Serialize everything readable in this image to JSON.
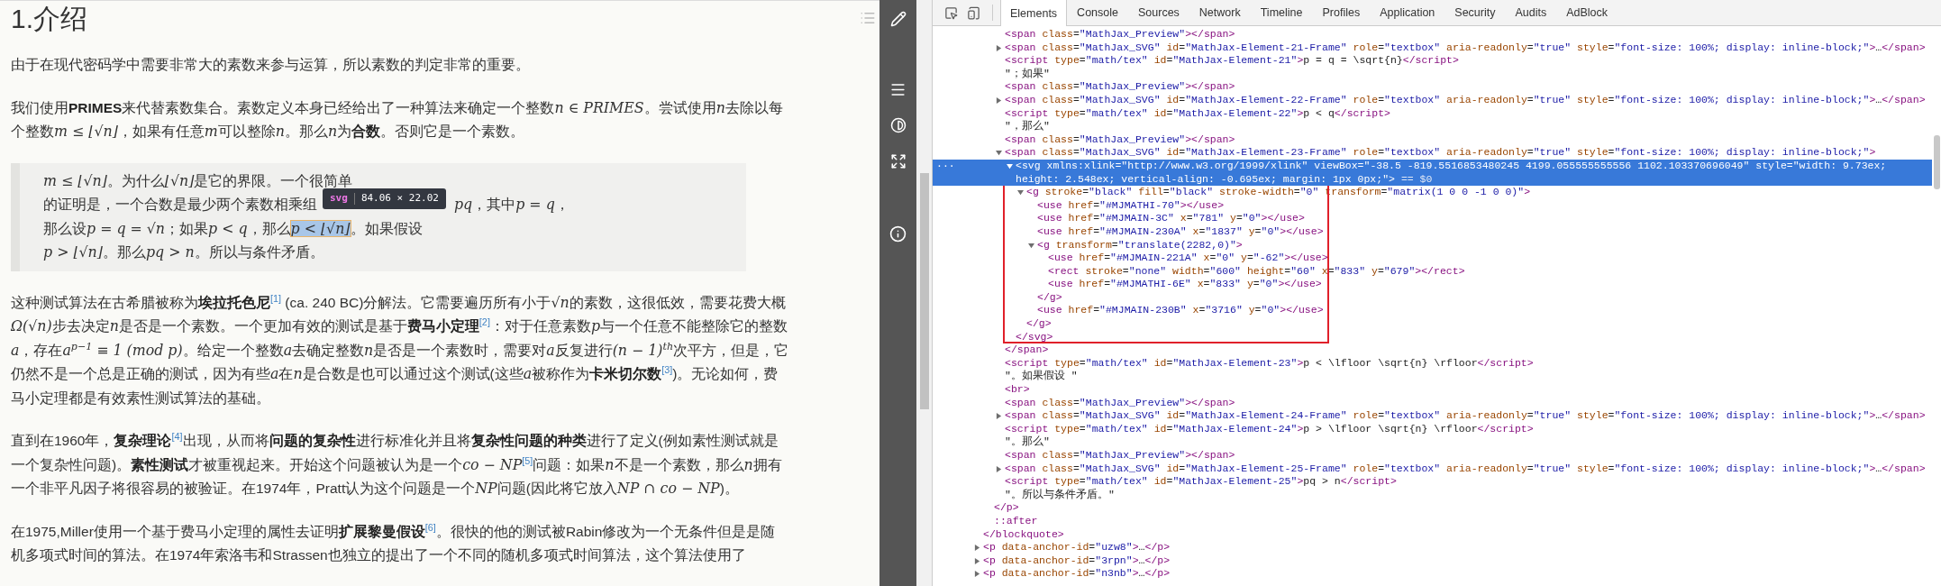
{
  "article": {
    "heading": "1.介绍",
    "blocks": [
      {
        "kind": "paragraph",
        "runs": [
          {
            "kind": "text",
            "text": "由于在现代密码学中需要非常大的素数来参与运算，所以素数的判定非常的重要。"
          }
        ]
      },
      {
        "kind": "paragraph",
        "runs": [
          {
            "kind": "text",
            "text": "我们使用**PRIMES**来代替素数集合。素数定义本身已经给出了一种算法来确定一个整数"
          },
          {
            "kind": "math",
            "text": "n ∈ PRIMES"
          },
          {
            "kind": "text",
            "text": "。尝试使用"
          },
          {
            "kind": "math",
            "text": "n"
          },
          {
            "kind": "text",
            "text": "去除以每个整数"
          },
          {
            "kind": "math",
            "text": "m ≤ ⌊√n⌋"
          },
          {
            "kind": "text",
            "text": "，如果有任意"
          },
          {
            "kind": "math",
            "text": "m"
          },
          {
            "kind": "text",
            "text": "可以整除"
          },
          {
            "kind": "math",
            "text": "n"
          },
          {
            "kind": "text",
            "text": "。那么"
          },
          {
            "kind": "math",
            "text": "n"
          },
          {
            "kind": "text",
            "text": "为**合数**。否则它是一个素数。"
          }
        ]
      },
      {
        "kind": "quote",
        "lines": [
          [
            {
              "kind": "math",
              "text": "m ≤ ⌊√n⌋"
            },
            {
              "kind": "text",
              "text": "。为什么"
            },
            {
              "kind": "math",
              "text": "⌊√n⌋"
            },
            {
              "kind": "text",
              "text": "是它的界限。一个很简单"
            }
          ],
          [
            {
              "kind": "text",
              "text": "的证明是，一个合数是最少两个素数相乘组"
            },
            {
              "kind": "gap",
              "tooltip": {
                "tag": "svg",
                "size": "84.06 × 22.02"
              }
            },
            {
              "kind": "math",
              "text": "pq"
            },
            {
              "kind": "text",
              "text": "，其中"
            },
            {
              "kind": "math",
              "text": "p = q"
            },
            {
              "kind": "text",
              "text": "，"
            }
          ],
          [
            {
              "kind": "text",
              "text": "那么设"
            },
            {
              "kind": "math",
              "text": "p = q = √n"
            },
            {
              "kind": "text",
              "text": "；如果"
            },
            {
              "kind": "math",
              "text": "p < q"
            },
            {
              "kind": "text",
              "text": "，那么"
            },
            {
              "kind": "highlight",
              "text": "p < ⌊√n⌋"
            },
            {
              "kind": "text",
              "text": "。如果假设"
            }
          ],
          [
            {
              "kind": "math",
              "text": "p > ⌊√n⌋"
            },
            {
              "kind": "text",
              "text": "。那么"
            },
            {
              "kind": "math",
              "text": "pq > n"
            },
            {
              "kind": "text",
              "text": "。所以与条件矛盾。"
            }
          ]
        ]
      },
      {
        "kind": "paragraph",
        "runs": [
          {
            "kind": "text",
            "text": "这种测试算法在古希腊被称为**埃拉托色尼**"
          },
          {
            "kind": "footnote",
            "text": "[1]"
          },
          {
            "kind": "text",
            "text": " (ca. 240 BC)分解法。它需要遍历所有小于"
          },
          {
            "kind": "math",
            "text": "√n"
          },
          {
            "kind": "text",
            "text": "的素数，这很低效，需要花费大概"
          },
          {
            "kind": "math",
            "text": "Ω(√n)"
          },
          {
            "kind": "text",
            "text": "步去决定"
          },
          {
            "kind": "math",
            "text": "n"
          },
          {
            "kind": "text",
            "text": "是否是一个素数。一个更加有效的测试是基于**费马小定理**"
          },
          {
            "kind": "footnote",
            "text": "[2]"
          },
          {
            "kind": "text",
            "text": "：对于任意素数"
          },
          {
            "kind": "math",
            "text": "p"
          },
          {
            "kind": "text",
            "text": "与一个任意不能整除它的整数"
          },
          {
            "kind": "math",
            "text": "a"
          },
          {
            "kind": "text",
            "text": "，存在"
          },
          {
            "kind": "math",
            "text": "a$^{p−1}$ ≡ 1 (mod p)"
          },
          {
            "kind": "text",
            "text": "。给定一个整数"
          },
          {
            "kind": "math",
            "text": "a"
          },
          {
            "kind": "text",
            "text": "去确定整数"
          },
          {
            "kind": "math",
            "text": "n"
          },
          {
            "kind": "text",
            "text": "是否是一个素数时，需要对"
          },
          {
            "kind": "math",
            "text": "a"
          },
          {
            "kind": "text",
            "text": "反复进行"
          },
          {
            "kind": "math",
            "text": "(n − 1)$^{th}$"
          },
          {
            "kind": "text",
            "text": "次平方，但是，它仍然不是一个总是正确的测试，因为有些"
          },
          {
            "kind": "math",
            "text": "a"
          },
          {
            "kind": "text",
            "text": "在"
          },
          {
            "kind": "math",
            "text": "n"
          },
          {
            "kind": "text",
            "text": "是合数是也可以通过这个测试(这些"
          },
          {
            "kind": "math",
            "text": "a"
          },
          {
            "kind": "text",
            "text": "被称作为**卡米切尔数**"
          },
          {
            "kind": "footnote",
            "text": "[3]"
          },
          {
            "kind": "text",
            "text": ")。无论如何，费马小定理都是有效素性测试算法的基础。"
          }
        ]
      },
      {
        "kind": "paragraph",
        "runs": [
          {
            "kind": "text",
            "text": "直到在1960年，**复杂理论**"
          },
          {
            "kind": "footnote",
            "text": "[4]"
          },
          {
            "kind": "text",
            "text": "出现，从而将**问题的复杂性**进行标准化并且将**复杂性问题的种类**进行了定义(例如素性测试就是一个复杂性问题)。**素性测试**才被重视起来。开始这个问题被认为是一个"
          },
          {
            "kind": "math",
            "text": "co − NP"
          },
          {
            "kind": "footnote",
            "text": "[5]"
          },
          {
            "kind": "text",
            "text": "问题：如果"
          },
          {
            "kind": "math",
            "text": "n"
          },
          {
            "kind": "text",
            "text": "不是一个素数，那么"
          },
          {
            "kind": "math",
            "text": "n"
          },
          {
            "kind": "text",
            "text": "拥有一个非平凡因子将很容易的被验证。在1974年，Pratt认为这个问题是一个"
          },
          {
            "kind": "math",
            "text": "NP"
          },
          {
            "kind": "text",
            "text": "问题(因此将它放入"
          },
          {
            "kind": "math",
            "text": "NP ∩ co − NP"
          },
          {
            "kind": "text",
            "text": ")。"
          }
        ]
      },
      {
        "kind": "paragraph",
        "runs": [
          {
            "kind": "text",
            "text": "在1975,Miller使用一个基于费马小定理的属性去证明**扩展黎曼假设**"
          },
          {
            "kind": "footnote",
            "text": "[6]"
          },
          {
            "kind": "text",
            "text": "。很快的他的测试被Rabin修改为一个无条件但是是随机多项式时间的算法。在1974年索洛韦和Strassen也独立的提出了一个不同的随机多项式时间算法，这个算法使用了"
          }
        ]
      }
    ]
  },
  "devtools": {
    "tabs": [
      {
        "label": "Elements",
        "selected": true
      },
      {
        "label": "Console",
        "selected": false
      },
      {
        "label": "Sources",
        "selected": false
      },
      {
        "label": "Network",
        "selected": false
      },
      {
        "label": "Timeline",
        "selected": false
      },
      {
        "label": "Profiles",
        "selected": false
      },
      {
        "label": "Application",
        "selected": false
      },
      {
        "label": "Security",
        "selected": false
      },
      {
        "label": "Audits",
        "selected": false
      },
      {
        "label": "AdBlock",
        "selected": false
      }
    ],
    "selected_gutter": "···",
    "console_ref": "== $0",
    "dom_tree": [
      {
        "close": "</blockquote>",
        "children": [
          {
            "close": "</p>",
            "children": [
              {
                "line": "<span class=\"MathJax_Preview\"></span>",
                "selected": false
              },
              {
                "line": "<span class=\"MathJax_SVG\" id=\"MathJax-Element-21-Frame\" role=\"textbox\" aria-readonly=\"true\" style=\"font-size: 100%; display: inline-block;\">…</span>",
                "expanded": false,
                "selected": false
              },
              {
                "line": "<script type=\"math/tex\" id=\"MathJax-Element-21\">p = q = \\sqrt{n}</script>",
                "selected": false
              },
              {
                "line": "\"；如果\"",
                "selected": false
              },
              {
                "line": "<span class=\"MathJax_Preview\"></span>",
                "selected": false
              },
              {
                "line": "<span class=\"MathJax_SVG\" id=\"MathJax-Element-22-Frame\" role=\"textbox\" aria-readonly=\"true\" style=\"font-size: 100%; display: inline-block;\">…</span>",
                "expanded": false,
                "selected": false
              },
              {
                "line": "<script type=\"math/tex\" id=\"MathJax-Element-22\">p < q</script>",
                "selected": false
              },
              {
                "line": "\"，那么\"",
                "selected": false
              },
              {
                "line": "<span class=\"MathJax_Preview\"></span>",
                "selected": false
              },
              {
                "line": "<span class=\"MathJax_SVG\" id=\"MathJax-Element-23-Frame\" role=\"textbox\" aria-readonly=\"true\" style=\"font-size: 100%; display: inline-block;\">",
                "expanded": true,
                "selected": false,
                "close": "</span>",
                "children": [
                  {
                    "line": "<svg xmlns:xlink=\"http://www.w3.org/1999/xlink\" viewBox=\"-38.5 -819.5516853480245 4199.055555555556 1102.103370696049\" style=\"width: 9.73ex; height: 2.548ex; vertical-align: -0.695ex; margin: 1px 0px;\">",
                    "expanded": true,
                    "selected": true,
                    "outlined": true,
                    "close": "</svg>",
                    "children": [
                      {
                        "line": "<g stroke=\"black\" fill=\"black\" stroke-width=\"0\" transform=\"matrix(1 0 0 -1 0 0)\">",
                        "expanded": true,
                        "selected": false,
                        "close": "</g>",
                        "children": [
                          {
                            "line": "<use href=\"#MJMATHI-70\"></use>",
                            "selected": false
                          },
                          {
                            "line": "<use href=\"#MJMAIN-3C\" x=\"781\" y=\"0\"></use>",
                            "selected": false
                          },
                          {
                            "line": "<use href=\"#MJMAIN-230A\" x=\"1837\" y=\"0\"></use>",
                            "selected": false
                          },
                          {
                            "line": "<g transform=\"translate(2282,0)\">",
                            "expanded": true,
                            "selected": false,
                            "close": "</g>",
                            "children": [
                              {
                                "line": "<use href=\"#MJMAIN-221A\" x=\"0\" y=\"-62\"></use>",
                                "selected": false
                              },
                              {
                                "line": "<rect stroke=\"none\" width=\"600\" height=\"60\" x=\"833\" y=\"679\"></rect>",
                                "selected": false
                              },
                              {
                                "line": "<use href=\"#MJMATHI-6E\" x=\"833\" y=\"0\"></use>",
                                "selected": false
                              }
                            ]
                          },
                          {
                            "line": "<use href=\"#MJMAIN-230B\" x=\"3716\" y=\"0\"></use>",
                            "selected": false
                          }
                        ]
                      }
                    ]
                  }
                ]
              },
              {
                "line": "<script type=\"math/tex\" id=\"MathJax-Element-23\">p < \\lfloor \\sqrt{n} \\rfloor</script>",
                "selected": false
              },
              {
                "line": "\"。如果假设 \"",
                "selected": false
              },
              {
                "line": "<br>",
                "selected": false
              },
              {
                "line": "<span class=\"MathJax_Preview\"></span>",
                "selected": false
              },
              {
                "line": "<span class=\"MathJax_SVG\" id=\"MathJax-Element-24-Frame\" role=\"textbox\" aria-readonly=\"true\" style=\"font-size: 100%; display: inline-block;\">…</span>",
                "expanded": false,
                "selected": false
              },
              {
                "line": "<script type=\"math/tex\" id=\"MathJax-Element-24\">p > \\lfloor \\sqrt{n} \\rfloor</script>",
                "selected": false
              },
              {
                "line": "\"。那么\"",
                "selected": false
              },
              {
                "line": "<span class=\"MathJax_Preview\"></span>",
                "selected": false
              },
              {
                "line": "<span class=\"MathJax_SVG\" id=\"MathJax-Element-25-Frame\" role=\"textbox\" aria-readonly=\"true\" style=\"font-size: 100%; display: inline-block;\">…</span>",
                "expanded": false,
                "selected": false
              },
              {
                "line": "<script type=\"math/tex\" id=\"MathJax-Element-25\">pq > n</script>",
                "selected": false
              },
              {
                "line": "\"。所以与条件矛盾。\"",
                "selected": false
              }
            ]
          },
          {
            "line": "::after",
            "selected": false
          }
        ]
      },
      {
        "line": "<p data-anchor-id=\"uzw8\">…</p>",
        "expanded": false,
        "selected": false
      },
      {
        "line": "<p data-anchor-id=\"3rpn\">…</p>",
        "expanded": false,
        "selected": false
      },
      {
        "line": "<p data-anchor-id=\"n3nb\">…</p>",
        "expanded": false,
        "selected": false
      }
    ]
  }
}
